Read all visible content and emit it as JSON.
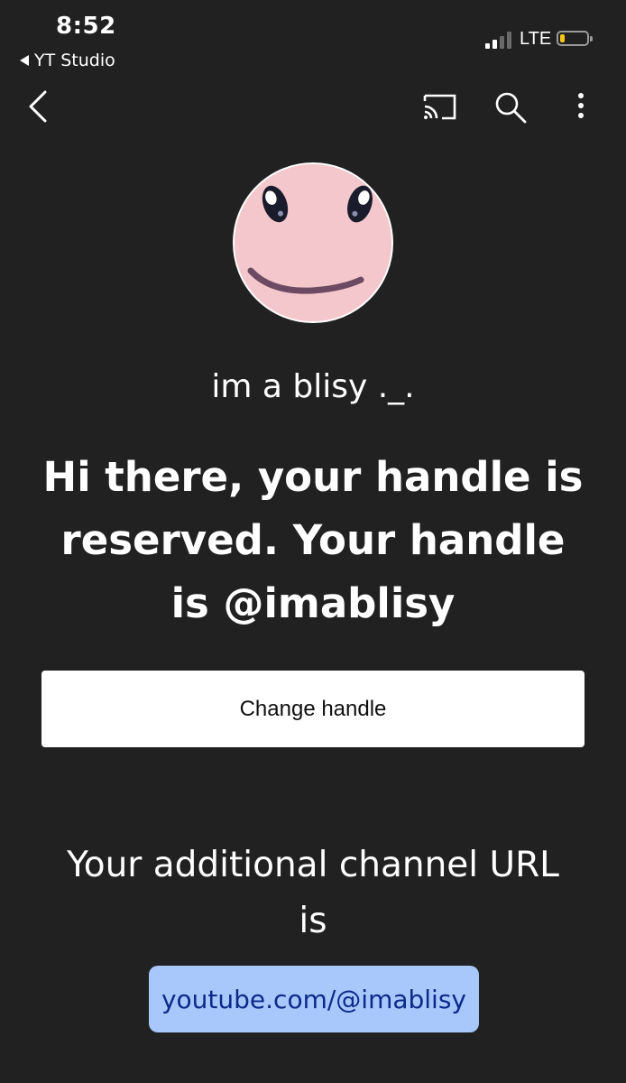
{
  "status_bar": {
    "time": "8:52",
    "back_app": "YT Studio",
    "network": "LTE"
  },
  "app_bar": {
    "icons": [
      "back-chevron-icon",
      "cast-icon",
      "search-icon",
      "more-vert-icon"
    ]
  },
  "profile": {
    "channel_name": "im a blisy ._.",
    "headline": "Hi there, your handle is reserved. Your handle is @imablisy"
  },
  "actions": {
    "change_handle_label": "Change handle"
  },
  "additional": {
    "text": "Your additional channel URL is",
    "url": "youtube.com/@imablisy"
  },
  "colors": {
    "background": "#212121",
    "button_bg": "#ffffff",
    "url_chip_bg": "#a8c7fa",
    "url_chip_text": "#0b2a8a",
    "battery_fill": "#f5c518"
  }
}
